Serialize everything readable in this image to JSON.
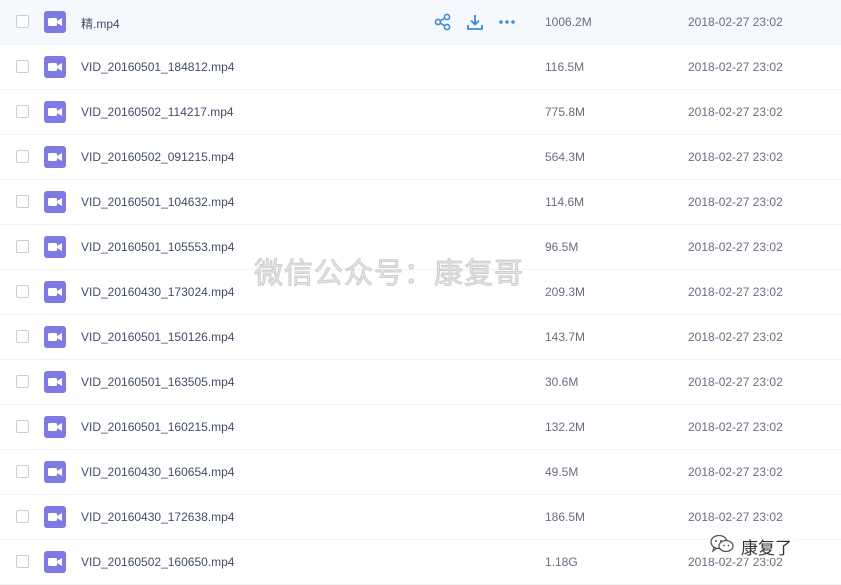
{
  "files": [
    {
      "name": "精.mp4",
      "size": "1006.2M",
      "date": "2018-02-27 23:02"
    },
    {
      "name": "VID_20160501_184812.mp4",
      "size": "116.5M",
      "date": "2018-02-27 23:02"
    },
    {
      "name": "VID_20160502_114217.mp4",
      "size": "775.8M",
      "date": "2018-02-27 23:02"
    },
    {
      "name": "VID_20160502_091215.mp4",
      "size": "564.3M",
      "date": "2018-02-27 23:02"
    },
    {
      "name": "VID_20160501_104632.mp4",
      "size": "114.6M",
      "date": "2018-02-27 23:02"
    },
    {
      "name": "VID_20160501_105553.mp4",
      "size": "96.5M",
      "date": "2018-02-27 23:02"
    },
    {
      "name": "VID_20160430_173024.mp4",
      "size": "209.3M",
      "date": "2018-02-27 23:02"
    },
    {
      "name": "VID_20160501_150126.mp4",
      "size": "143.7M",
      "date": "2018-02-27 23:02"
    },
    {
      "name": "VID_20160501_163505.mp4",
      "size": "30.6M",
      "date": "2018-02-27 23:02"
    },
    {
      "name": "VID_20160501_160215.mp4",
      "size": "132.2M",
      "date": "2018-02-27 23:02"
    },
    {
      "name": "VID_20160430_160654.mp4",
      "size": "49.5M",
      "date": "2018-02-27 23:02"
    },
    {
      "name": "VID_20160430_172638.mp4",
      "size": "186.5M",
      "date": "2018-02-27 23:02"
    },
    {
      "name": "VID_20160502_160650.mp4",
      "size": "1.18G",
      "date": "2018-02-27 23:02"
    }
  ],
  "row_actions": [
    "share-icon",
    "download-icon",
    "more-icon"
  ],
  "file_icon": "video-file-icon",
  "colors": {
    "accent": "#3b8cd9",
    "video_icon": "#7f79e3",
    "active_row": "#f5f9fe"
  },
  "watermark": "微信公众号：康复哥",
  "wechat_badge": {
    "icon": "wechat-logo-icon",
    "name": "康复了"
  }
}
